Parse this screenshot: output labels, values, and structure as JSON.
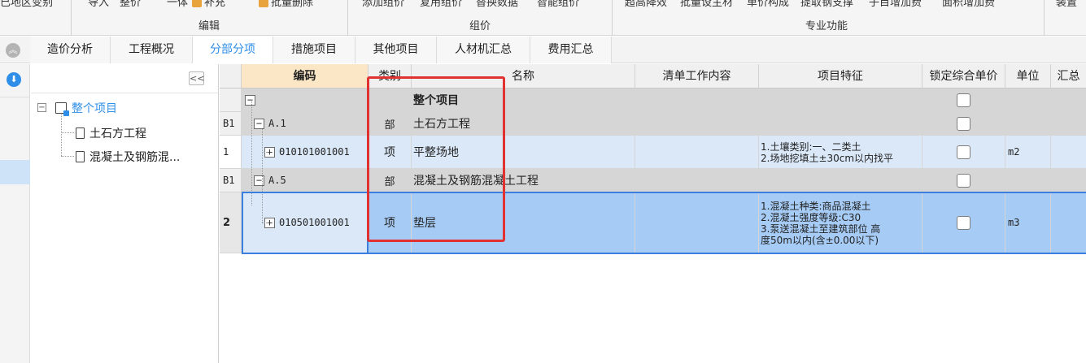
{
  "ribbon": {
    "cut_items": [
      "已地区变别",
      "导入",
      "整价",
      "一体",
      "补充",
      "批量删除",
      "添加组价",
      "复用组价",
      "替换数据",
      "智能组价",
      "超高降效",
      "批量设主材",
      "单价构成",
      "提取钢支撑",
      "子目增加费",
      "面积增加费",
      "装置"
    ],
    "groups": [
      "编辑",
      "组价",
      "专业功能"
    ]
  },
  "tabs": [
    "造价分析",
    "工程概况",
    "分部分项",
    "措施项目",
    "其他项目",
    "人材机汇总",
    "费用汇总"
  ],
  "active_tab": "分部分项",
  "icons": {
    "collapse": "double-chevron-up-icon",
    "expand_down": "download-arrow-icon",
    "fold_tree": "double-chevron-left-icon"
  },
  "tree": {
    "fold_label": "<<",
    "root": "整个项目",
    "children": [
      "土石方工程",
      "混凝土及钢筋混..."
    ]
  },
  "columns": [
    "",
    "编码",
    "类别",
    "名称",
    "清单工作内容",
    "项目特征",
    "锁定综合单价",
    "单位",
    "汇总"
  ],
  "rows": [
    {
      "num": "",
      "code": "",
      "type": "",
      "name": "整个项目",
      "work": "",
      "feature": "",
      "unit": ""
    },
    {
      "num": "B1",
      "code": "A.1",
      "type": "部",
      "name": "土石方工程",
      "work": "",
      "feature": "",
      "unit": ""
    },
    {
      "num": "1",
      "code": "010101001001",
      "type": "项",
      "name": "平整场地",
      "work": "",
      "feature": "1.土壤类别:一、二类土\n2.场地挖填土±30cm以内找平",
      "unit": "m2"
    },
    {
      "num": "B1",
      "code": "A.5",
      "type": "部",
      "name": "混凝土及钢筋混凝土工程",
      "work": "",
      "feature": "",
      "unit": ""
    },
    {
      "num": "2",
      "code": "010501001001",
      "type": "项",
      "name": "垫层",
      "work": "",
      "feature": "1.混凝土种类:商品混凝土\n2.混凝土强度等级:C30\n3.泵送混凝土至建筑部位 高\n度50m以内(含±0.00以下)",
      "unit": "m3"
    }
  ],
  "colors": {
    "accent": "#2f8ee8",
    "highlight_frame": "#e23131",
    "selected_row": "#a6cbf5",
    "row_blue": "#dbe8f8",
    "header_code": "#fbe7c6"
  }
}
